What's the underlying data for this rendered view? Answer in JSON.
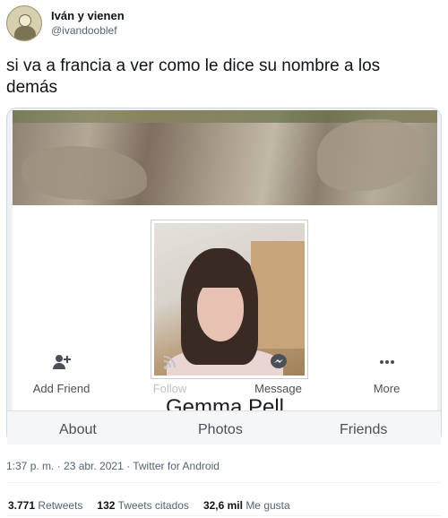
{
  "tweet": {
    "author": {
      "display_name": "Iván y vienen",
      "handle": "@ivandooblef",
      "avatar_icon": "user-avatar"
    },
    "text": "si va a francia a ver como le dice su nombre a los demás",
    "meta": "1:37 p. m. · 23 abr. 2021 · Twitter for Android",
    "stats": {
      "retweets_count": "3.771",
      "retweets_label": "Retweets",
      "quotes_count": "132",
      "quotes_label": "Tweets citados",
      "likes_count": "32,6 mil",
      "likes_label": "Me gusta"
    }
  },
  "embedded_profile": {
    "name": "Gemma Pell",
    "actions": [
      {
        "label": "Add Friend",
        "icon": "add-friend-icon",
        "enabled": true
      },
      {
        "label": "Follow",
        "icon": "follow-icon",
        "enabled": false
      },
      {
        "label": "Message",
        "icon": "messenger-icon",
        "enabled": true
      },
      {
        "label": "More",
        "icon": "more-icon",
        "enabled": true
      }
    ],
    "tabs": [
      "About",
      "Photos",
      "Friends"
    ]
  },
  "colors": {
    "text_primary": "#0f1419",
    "text_secondary": "#536471",
    "fb_action_gray": "#4b4f56",
    "fb_disabled_gray": "#bec3c9"
  }
}
